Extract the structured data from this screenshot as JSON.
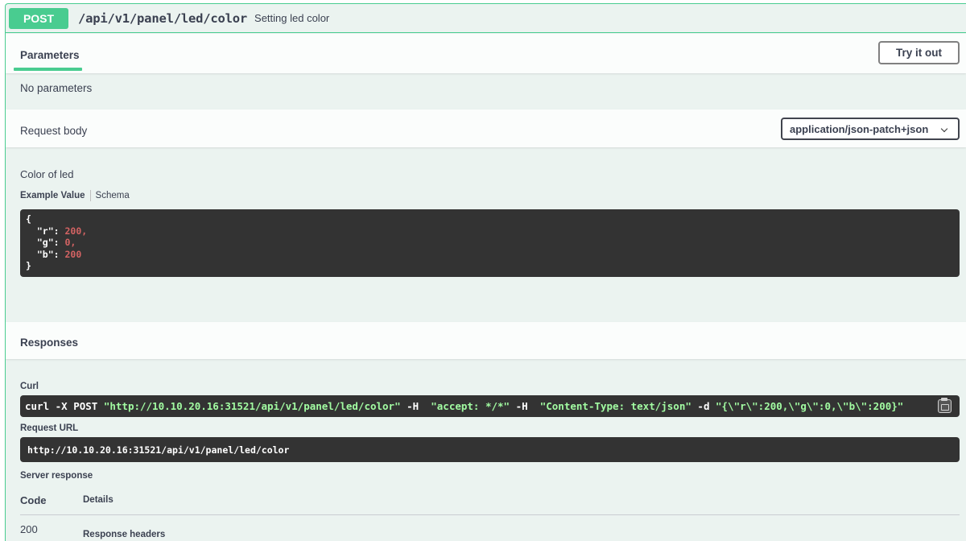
{
  "operation": {
    "method": "POST",
    "path": "/api/v1/panel/led/color",
    "summary": "Setting led color"
  },
  "parameters": {
    "tab_label": "Parameters",
    "try_button": "Try it out",
    "empty_text": "No parameters"
  },
  "request_body": {
    "label": "Request body",
    "content_type": "application/json-patch+json",
    "description": "Color of led",
    "tabs": {
      "example": "Example Value",
      "schema": "Schema"
    },
    "example": {
      "open": "{",
      "close": "}",
      "fields": [
        {
          "key": "\"r\": ",
          "value": "200,",
          "indent": "  "
        },
        {
          "key": "\"g\": ",
          "value": "0,",
          "indent": "  "
        },
        {
          "key": "\"b\": ",
          "value": "200",
          "indent": "  "
        }
      ]
    }
  },
  "responses": {
    "title": "Responses",
    "curl_label": "Curl",
    "curl": {
      "prefix": "curl -X POST ",
      "url": "\"http://10.10.20.16:31521/api/v1/panel/led/color\"",
      "h1_flag": " -H  ",
      "h1": "\"accept: */*\"",
      "h2_flag": " -H  ",
      "h2": "\"Content-Type: text/json\"",
      "d_flag": " -d ",
      "d": "\"{\\\"r\\\":200,\\\"g\\\":0,\\\"b\\\":200}\""
    },
    "request_url_label": "Request URL",
    "request_url": "http://10.10.20.16:31521/api/v1/panel/led/color",
    "server_response_label": "Server response",
    "table": {
      "code_header": "Code",
      "details_header": "Details",
      "row_code": "200",
      "row_details": "Response headers"
    }
  },
  "colors": {
    "accent": "#49cc90",
    "background": "#ebf3f0",
    "code_bg": "#333333",
    "number": "#d36363",
    "string": "#a2fca2"
  }
}
